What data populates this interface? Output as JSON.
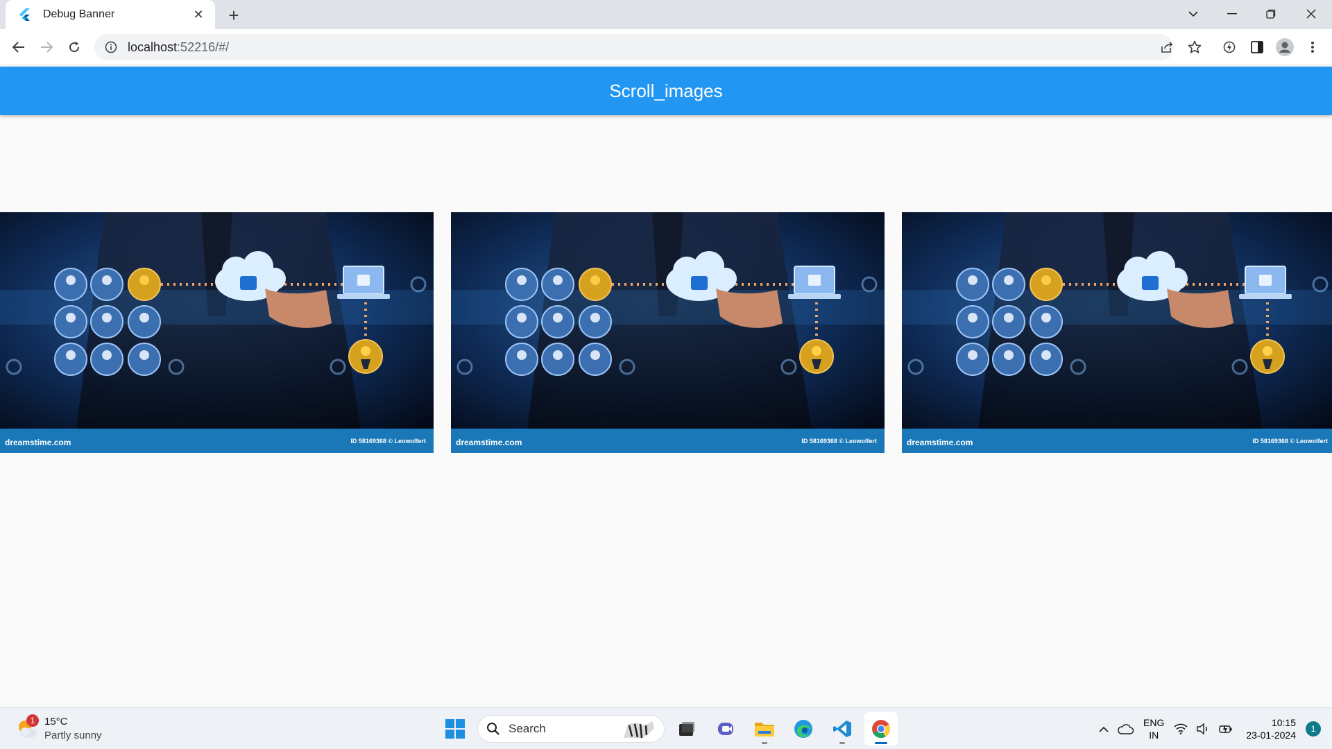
{
  "browser": {
    "tab_title": "Debug Banner",
    "url_host": "localhost",
    "url_rest": ":52216/#/"
  },
  "app": {
    "title": "Scroll_images"
  },
  "images": [
    {
      "watermark": "dreamstime.com",
      "credit": "ID 58169368 © Leowolfert"
    },
    {
      "watermark": "dreamstime.com",
      "credit": "ID 58169368 © Leowolfert"
    },
    {
      "watermark": "dreamstime.com",
      "credit": "ID 58169368 © Leowolfert"
    }
  ],
  "taskbar": {
    "weather_temp": "15°C",
    "weather_condition": "Partly sunny",
    "weather_badge": "1",
    "search_label": "Search",
    "lang_line1": "ENG",
    "lang_line2": "IN",
    "time": "10:15",
    "date": "23-01-2024",
    "notification_count": "1"
  },
  "colors": {
    "appbar": "#2196f3",
    "page_background": "#fafafa",
    "image_footer": "#1a78b8"
  }
}
